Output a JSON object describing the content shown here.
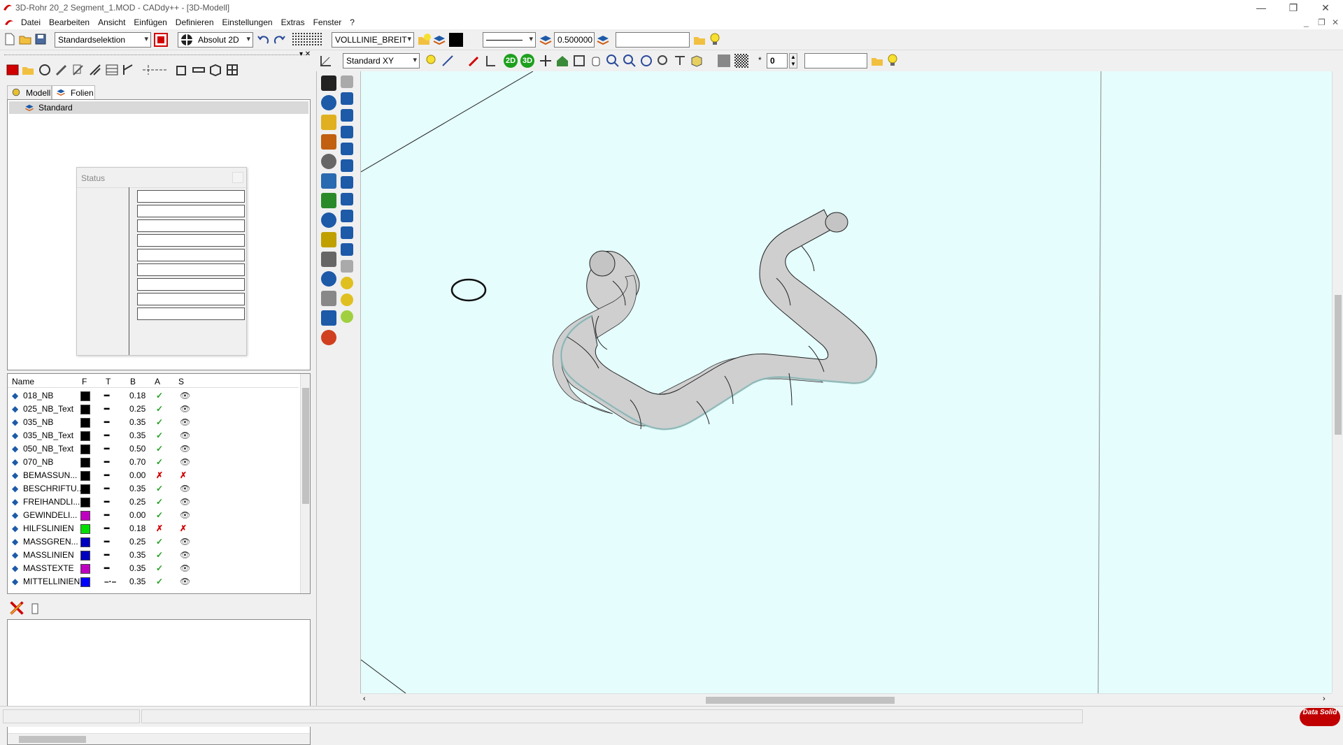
{
  "window": {
    "title": "3D-Rohr 20_2 Segment_1.MOD  -  CADdy++ - [3D-Modell]",
    "controls": {
      "minimize": "—",
      "maximize": "❐",
      "close": "✕"
    }
  },
  "menu": [
    "Datei",
    "Bearbeiten",
    "Ansicht",
    "Einfügen",
    "Definieren",
    "Einstellungen",
    "Extras",
    "Fenster",
    "?"
  ],
  "toolbar1": {
    "selection_mode": "Standardselektion",
    "coord_mode": "Absolut 2D",
    "line_type": "VOLLLINIE_BREIT",
    "line_width": "0.500000",
    "color": "#000000",
    "text_field": ""
  },
  "toolbar2": {
    "view_mode": "Standard XY",
    "btn_2d": "2D",
    "btn_3d": "3D",
    "number_value": "0",
    "text_field": ""
  },
  "left_panel": {
    "tabs": [
      "Modell",
      "Folien"
    ],
    "active_tab": "Folien",
    "tree_item": "Standard",
    "status_popup_title": "Status",
    "layer_table": {
      "headers": [
        "Name",
        "F",
        "T",
        "B",
        "A",
        "S"
      ],
      "rows": [
        {
          "name": "018_NB",
          "color": "#000000",
          "line": "solid",
          "width": "0.18",
          "active": "✓",
          "visible": "👁"
        },
        {
          "name": "025_NB_Text",
          "color": "#000000",
          "line": "solid",
          "width": "0.25",
          "active": "✓",
          "visible": "👁"
        },
        {
          "name": "035_NB",
          "color": "#000000",
          "line": "solid",
          "width": "0.35",
          "active": "✓",
          "visible": "👁"
        },
        {
          "name": "035_NB_Text",
          "color": "#000000",
          "line": "solid",
          "width": "0.35",
          "active": "✓",
          "visible": "👁"
        },
        {
          "name": "050_NB_Text",
          "color": "#000000",
          "line": "solid",
          "width": "0.50",
          "active": "✓",
          "visible": "👁"
        },
        {
          "name": "070_NB",
          "color": "#000000",
          "line": "solid",
          "width": "0.70",
          "active": "✓",
          "visible": "👁"
        },
        {
          "name": "BEMASSUN...",
          "color": "#000000",
          "line": "solid",
          "width": "0.00",
          "active": "✗",
          "visible": "✗"
        },
        {
          "name": "BESCHRIFTU...",
          "color": "#000000",
          "line": "solid",
          "width": "0.35",
          "active": "✓",
          "visible": "👁"
        },
        {
          "name": "FREIHANDLI...",
          "color": "#000000",
          "line": "solid",
          "width": "0.25",
          "active": "✓",
          "visible": "👁"
        },
        {
          "name": "GEWINDELI...",
          "color": "#c000c0",
          "line": "solid",
          "width": "0.00",
          "active": "✓",
          "visible": "👁"
        },
        {
          "name": "HILFSLINIEN",
          "color": "#00e000",
          "line": "solid",
          "width": "0.18",
          "active": "✗",
          "visible": "✗"
        },
        {
          "name": "MASSGREN...",
          "color": "#0000c0",
          "line": "solid",
          "width": "0.25",
          "active": "✓",
          "visible": "👁"
        },
        {
          "name": "MASSLINIEN",
          "color": "#0000c0",
          "line": "solid",
          "width": "0.35",
          "active": "✓",
          "visible": "👁"
        },
        {
          "name": "MASSTEXTE",
          "color": "#c000c0",
          "line": "solid",
          "width": "0.35",
          "active": "✓",
          "visible": "👁"
        },
        {
          "name": "MITTELLINIEN",
          "color": "#0000ff",
          "line": "dashdot",
          "width": "0.35",
          "active": "✓",
          "visible": "👁"
        }
      ]
    }
  },
  "icons": {
    "check_color": "#20a020",
    "cross_color": "#d00000"
  },
  "viewport": {
    "background": "#e5fdfd",
    "pipe_color": "#cfcfcf"
  },
  "brand": "Data Solid"
}
